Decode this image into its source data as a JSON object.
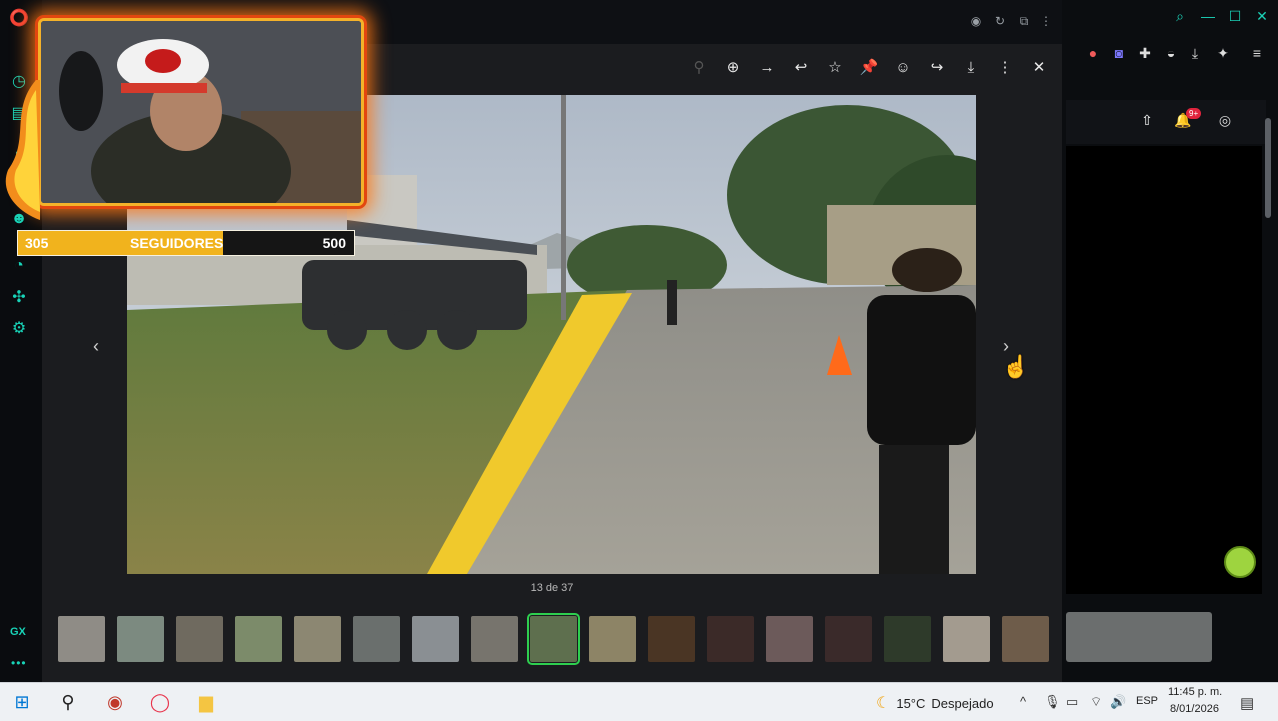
{
  "viewer": {
    "counter": "13 de 37",
    "prev_glyph": "‹",
    "next_glyph": "›",
    "toolbar": [
      {
        "name": "zoom-out-icon",
        "glyph": "⚲"
      },
      {
        "name": "zoom-in-icon",
        "glyph": "⊕"
      },
      {
        "name": "forward-arrow-icon",
        "glyph": "→"
      },
      {
        "name": "reply-icon",
        "glyph": "↩"
      },
      {
        "name": "star-icon",
        "glyph": "☆"
      },
      {
        "name": "pin-icon",
        "glyph": "📌"
      },
      {
        "name": "emoji-icon",
        "glyph": "☺"
      },
      {
        "name": "share-icon",
        "glyph": "↪"
      },
      {
        "name": "download-icon",
        "glyph": "⤓"
      },
      {
        "name": "more-options-icon",
        "glyph": "⋮"
      },
      {
        "name": "close-icon",
        "glyph": "✕"
      }
    ],
    "thumbnail_count": 17,
    "active_thumbnail": 8
  },
  "overlay": {
    "followers_count": "305",
    "followers_label": "SEGUIDORES",
    "followers_goal": "500",
    "progress_fraction": 0.61
  },
  "right_panel": {
    "notification_badge": "9+"
  },
  "sidebar": {
    "gx_label": "GX",
    "more": "•••"
  },
  "taskbar": {
    "temperature": "15°C",
    "weather": "Despejado",
    "language": "ESP",
    "time": "11:45 p. m.",
    "date": "8/01/2026"
  },
  "colors": {
    "accent_teal": "#18d4b8",
    "followers_bar": "#f1b31d",
    "active_thumb": "#2ecf4f"
  }
}
